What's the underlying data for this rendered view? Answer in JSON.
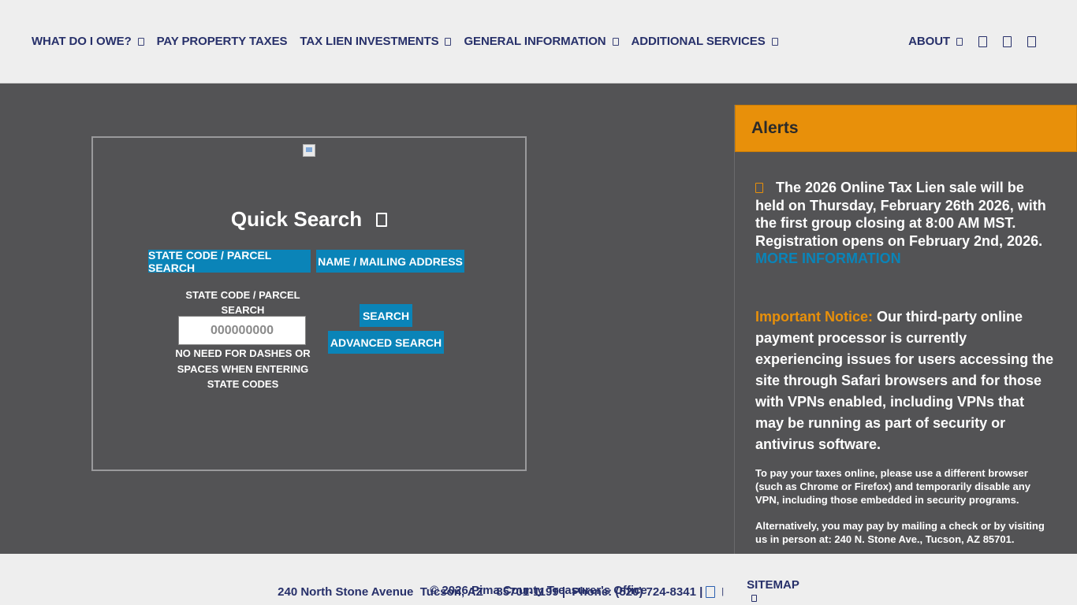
{
  "nav": {
    "items": [
      {
        "label": "WHAT DO I OWE?",
        "has_dropdown": true
      },
      {
        "label": "PAY PROPERTY TAXES",
        "has_dropdown": false
      },
      {
        "label": "TAX LIEN INVESTMENTS",
        "has_dropdown": true
      },
      {
        "label": "GENERAL INFORMATION",
        "has_dropdown": true
      },
      {
        "label": "ADDITIONAL SERVICES",
        "has_dropdown": true
      }
    ],
    "about": "ABOUT",
    "right_icons": [
      "square-glyph-icon",
      "square-glyph-icon",
      "square-glyph-icon"
    ]
  },
  "quick_search": {
    "title": "Quick Search",
    "tabs": [
      {
        "label": "STATE CODE / PARCEL SEARCH"
      },
      {
        "label": "NAME / MAILING ADDRESS"
      }
    ],
    "field_label": "STATE CODE / PARCEL SEARCH",
    "input_placeholder": "000000000",
    "hint": "NO NEED FOR DASHES OR SPACES WHEN ENTERING STATE CODES",
    "search_button": "SEARCH",
    "advanced_button": "ADVANCED SEARCH"
  },
  "alerts": {
    "heading": "Alerts",
    "main_text": "The 2026 Online Tax Lien sale will be held on Thursday, February 26th 2026, with the first group closing at 8:00 AM MST. Registration opens on February 2nd, 2026.",
    "more_link": "MORE INFORMATION",
    "notice_label": "Important Notice:",
    "notice_text": "Our third-party online payment processor is currently experiencing issues for users accessing the site through Safari browsers and for those with VPNs enabled, including VPNs that may be running as part of security or antivirus software.",
    "para1": "To pay your taxes online, please use a different browser (such as Chrome or Firefox) and temporarily disable any VPN, including those embedded in security programs.",
    "para2": "Alternatively, you may pay by mailing a check or by visiting us in person at: 240 N. Stone Ave., Tucson, AZ 85701."
  },
  "footer": {
    "address": "240 North Stone Avenue  Tucson, AZ    85701-1199 |  Phone: (520) 724-8341 |",
    "sep": "|",
    "sitemap": "SITEMAP",
    "copyright": "© 2026 Pima County Treasurer's Office"
  },
  "colors": {
    "accent_blue": "#0a84b8",
    "alert_orange": "#e8900a",
    "nav_text": "#27306a",
    "page_bg": "#535355"
  }
}
